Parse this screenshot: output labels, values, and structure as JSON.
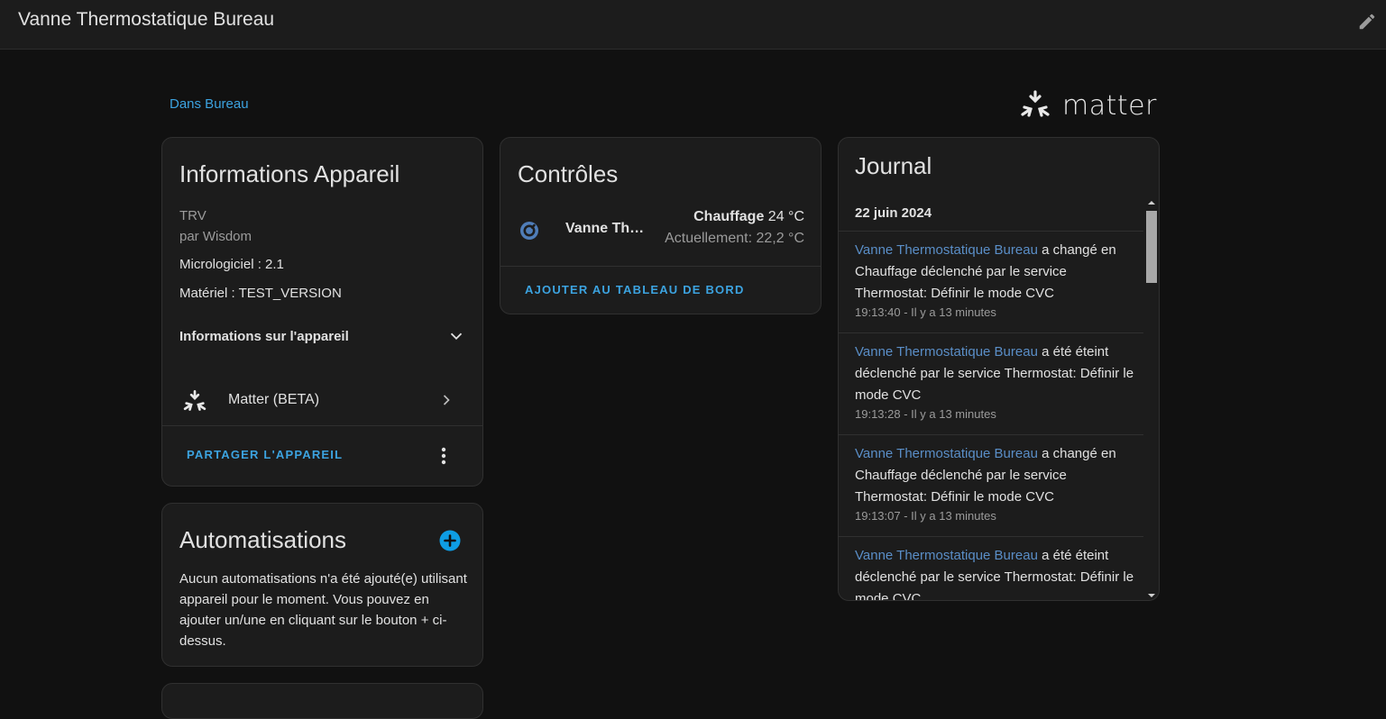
{
  "header": {
    "title": "Vanne Thermostatique Bureau",
    "edit_icon": "pencil-icon"
  },
  "area_link": "Dans Bureau",
  "brand": {
    "logo_icon": "matter-logo-icon",
    "word": "matter"
  },
  "device_info": {
    "title": "Informations Appareil",
    "model": "TRV",
    "manufacturer": "par Wisdom",
    "firmware": "Micrologiciel : 2.1",
    "hardware": "Matériel : TEST_VERSION",
    "expand_label": "Informations sur l'appareil",
    "integration_label": "Matter (BETA)",
    "share_label": "PARTAGER L'APPAREIL"
  },
  "automations": {
    "title": "Automatisations",
    "empty_text": "Aucun automatisations n'a été ajouté(e) utilisant appareil pour le moment. Vous pouvez en ajouter un/une en cliquant sur le bouton + ci-dessus."
  },
  "controls": {
    "title": "Contrôles",
    "entity_name": "Vanne Thermostatique Bureau",
    "entity_name_display": "Vanne Ther…",
    "mode": "Chauffage",
    "target": "24 °C",
    "current": "Actuellement: 22,2 °C",
    "add_dashboard_label": "AJOUTER AU TABLEAU DE BORD"
  },
  "logbook": {
    "title": "Journal",
    "date": "22 juin 2024",
    "entries": [
      {
        "entity": "Vanne Thermostatique Bureau",
        "text": " a changé en Chauffage déclenché par le service Thermostat: Définir le mode CVC",
        "time": "19:13:40 - Il y a 13 minutes"
      },
      {
        "entity": "Vanne Thermostatique Bureau",
        "text": " a été éteint déclenché par le service Thermostat: Définir le mode CVC",
        "time": "19:13:28 - Il y a 13 minutes"
      },
      {
        "entity": "Vanne Thermostatique Bureau",
        "text": " a changé en Chauffage déclenché par le service Thermostat: Définir le mode CVC",
        "time": "19:13:07 - Il y a 13 minutes"
      },
      {
        "entity": "Vanne Thermostatique Bureau",
        "text": " a été éteint déclenché par le service Thermostat: Définir le mode CVC",
        "time": ""
      }
    ]
  },
  "colors": {
    "accent": "#3ca3e0",
    "entity_link": "#5a8ec7",
    "background": "#111111",
    "card": "#1c1c1c"
  }
}
